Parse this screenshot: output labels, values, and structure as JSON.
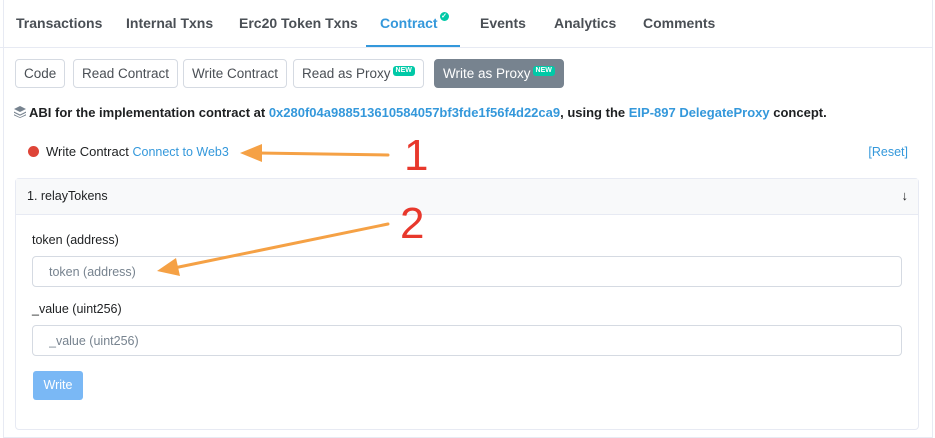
{
  "tabs": [
    {
      "label": "Transactions"
    },
    {
      "label": "Internal Txns"
    },
    {
      "label": "Erc20 Token Txns"
    },
    {
      "label": "Contract",
      "active": true
    },
    {
      "label": "Events"
    },
    {
      "label": "Analytics"
    },
    {
      "label": "Comments"
    }
  ],
  "subtabs": {
    "code": "Code",
    "read_contract": "Read Contract",
    "write_contract": "Write Contract",
    "read_as_proxy": "Read as Proxy",
    "write_as_proxy": "Write as Proxy",
    "new_badge": "NEW"
  },
  "abi_notice": {
    "prefix": "ABI for the implementation contract at ",
    "address": "0x280f04a988513610584057bf3fde1f56f4d22ca9",
    "middle": ", using the ",
    "eip": "EIP-897 DelegateProxy",
    "suffix": " concept."
  },
  "status": {
    "label": "Write Contract",
    "connect": "Connect to Web3",
    "reset": "[Reset]"
  },
  "method": {
    "title": "1. relayTokens",
    "params": [
      {
        "label": "token (address)",
        "placeholder": "token (address)"
      },
      {
        "label": "_value (uint256)",
        "placeholder": "_value (uint256)"
      }
    ],
    "write_label": "Write"
  },
  "annotations": {
    "one": "1",
    "two": "2",
    "color": "#f5a145",
    "number_color": "#e8382c"
  },
  "colors": {
    "accent": "#3498db",
    "success": "#00c9a7",
    "danger": "#de4437"
  }
}
